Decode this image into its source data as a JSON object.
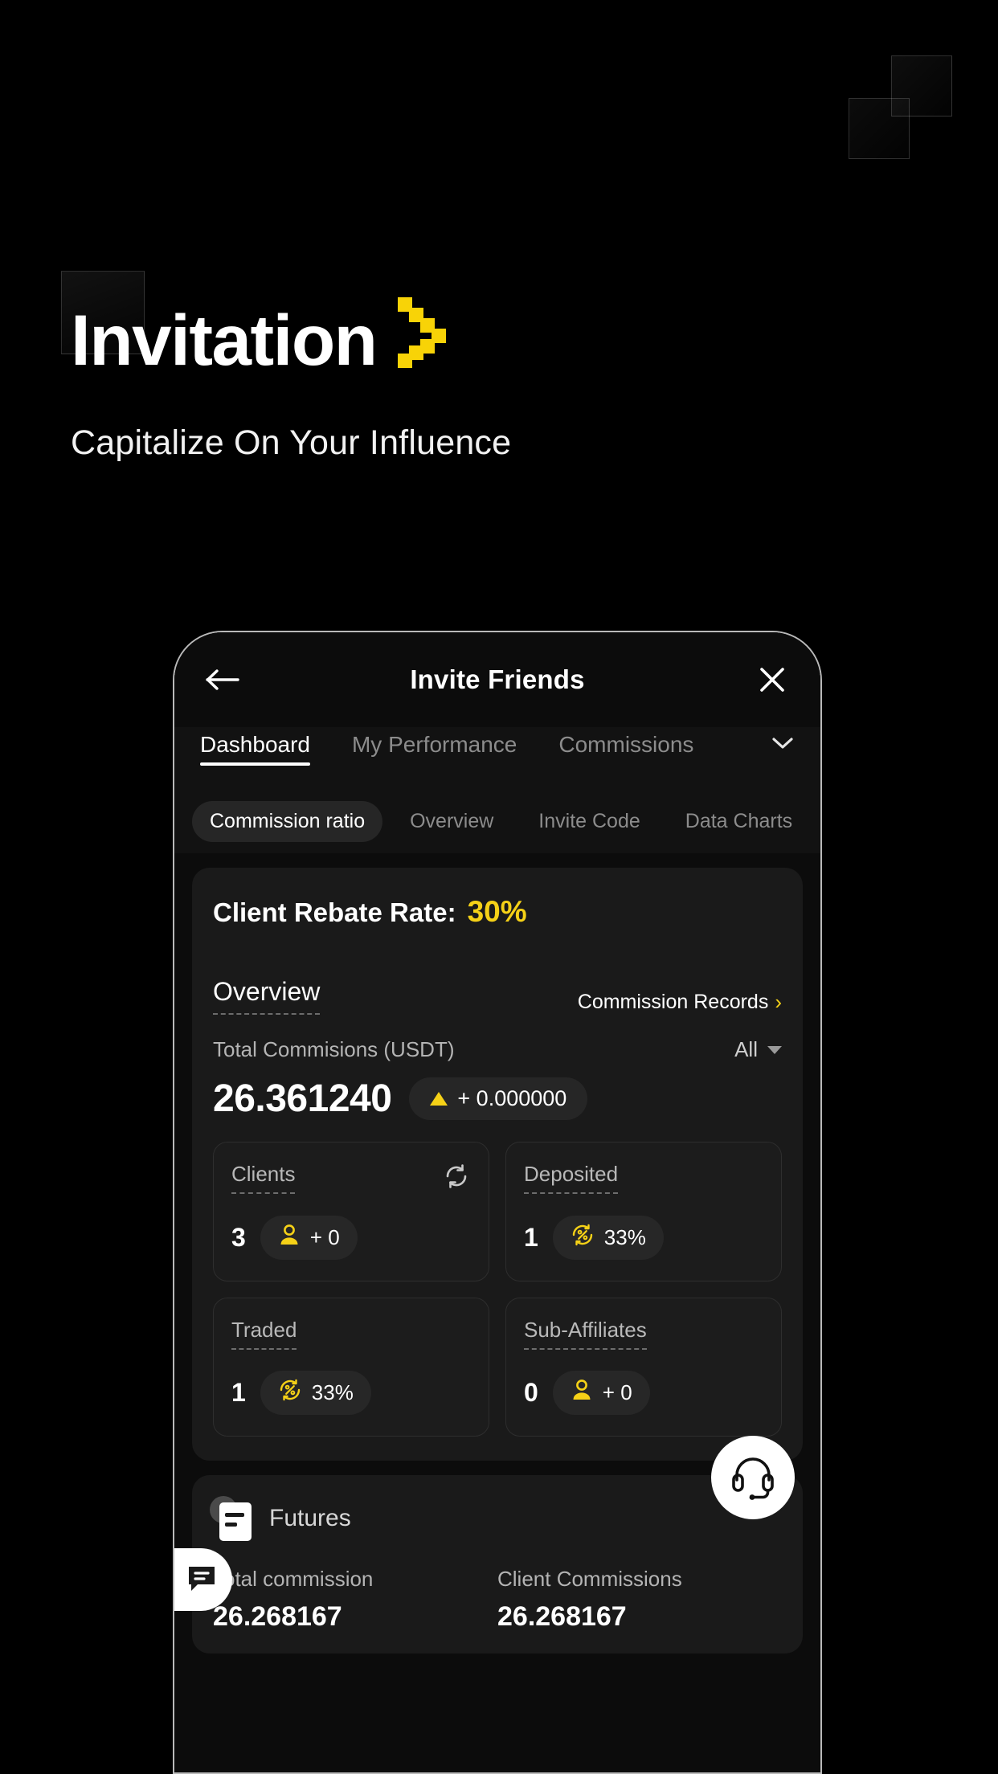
{
  "hero": {
    "title": "Invitation",
    "subtitle": "Capitalize On Your Influence",
    "chevron_icon": "pixel-chevron-right-icon",
    "accent_color": "#F8D307"
  },
  "phone": {
    "navbar": {
      "back_icon": "arrow-left-icon",
      "title": "Invite Friends",
      "close_icon": "close-icon"
    },
    "tabs": [
      {
        "label": "Dashboard",
        "active": true
      },
      {
        "label": "My Performance",
        "active": false
      },
      {
        "label": "Commissions",
        "active": false
      }
    ],
    "tabs_caret_icon": "chevron-down-icon",
    "subtabs": [
      {
        "label": "Commission ratio",
        "active": true
      },
      {
        "label": "Overview",
        "active": false
      },
      {
        "label": "Invite Code",
        "active": false
      },
      {
        "label": "Data Charts",
        "active": false
      }
    ],
    "main_card": {
      "rebate_label": "Client Rebate Rate:",
      "rebate_value": "30%",
      "overview_title": "Overview",
      "commission_records_label": "Commission Records",
      "commission_records_chevron": "›",
      "total_label": "Total Commisions (USDT)",
      "filter_value": "All",
      "total_value": "26.361240",
      "delta_badge": "+ 0.000000",
      "delta_icon": "triangle-up-icon"
    },
    "stats": [
      {
        "label": "Clients",
        "value": "3",
        "pill_text": "+ 0",
        "pill_icon": "person-icon",
        "action_icon": "refresh-icon"
      },
      {
        "label": "Deposited",
        "value": "1",
        "pill_text": "33%",
        "pill_icon": "percent-circle-icon",
        "action_icon": ""
      },
      {
        "label": "Traded",
        "value": "1",
        "pill_text": "33%",
        "pill_icon": "percent-circle-icon",
        "action_icon": ""
      },
      {
        "label": "Sub-Affiliates",
        "value": "0",
        "pill_text": "+ 0",
        "pill_icon": "person-icon",
        "action_icon": ""
      }
    ],
    "futures": {
      "title": "Futures",
      "icon": "document-icon",
      "columns": [
        {
          "label": "Total commission",
          "value": "26.268167"
        },
        {
          "label": "Client Commissions",
          "value": "26.268167"
        }
      ]
    },
    "chat_tab_icon": "chat-bubble-icon",
    "support_button_icon": "headset-icon"
  }
}
